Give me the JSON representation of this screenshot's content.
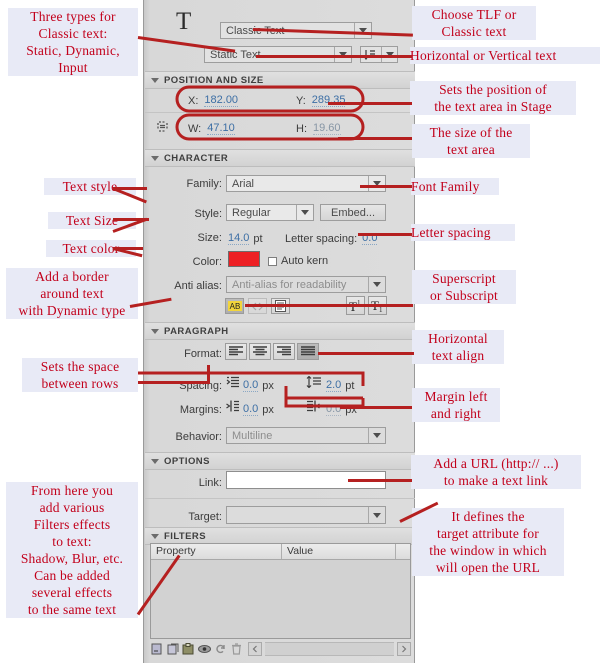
{
  "panel": {
    "title_icon": "text-tool-T",
    "text_engine": {
      "value": "Classic Text",
      "icon": "chevron-down-icon"
    },
    "text_type": {
      "value": "Static Text",
      "icon": "chevron-down-icon"
    },
    "orientation": {
      "icon": "text-orientation-icon",
      "caret": "chevron-down-icon"
    },
    "sections": {
      "position_size": {
        "title": "POSITION AND SIZE",
        "x_label": "X:",
        "x_value": "182.00",
        "y_label": "Y:",
        "y_value": "289.35",
        "w_label": "W:",
        "w_value": "47.10",
        "h_label": "H:",
        "h_value": "19.60",
        "lock_icon": "link-constrain-icon"
      },
      "character": {
        "title": "CHARACTER",
        "family_label": "Family:",
        "family_value": "Arial",
        "style_label": "Style:",
        "style_value": "Regular",
        "embed_label": "Embed...",
        "size_label": "Size:",
        "size_value": "14.0",
        "size_unit": "pt",
        "letter_spacing_label": "Letter spacing:",
        "letter_spacing_value": "0.0",
        "color_label": "Color:",
        "color_value": "#ED2024",
        "auto_kern_label": "Auto kern",
        "antialias_label": "Anti alias:",
        "antialias_value": "Anti-alias for readability",
        "toggle_selectable": "selectable-AB-icon",
        "toggle_html": "render-html-icon",
        "toggle_border": "show-border-icon",
        "superscript": "superscript-icon",
        "subscript": "subscript-icon"
      },
      "paragraph": {
        "title": "PARAGRAPH",
        "format_label": "Format:",
        "align_left": "align-left-icon",
        "align_center": "align-center-icon",
        "align_right": "align-right-icon",
        "align_justify": "align-justify-icon",
        "spacing_label": "Spacing:",
        "indent_value": "0.0",
        "indent_unit": "px",
        "indent_icon": "indent-icon",
        "line_spacing_value": "2.0",
        "line_spacing_unit": "pt",
        "line_spacing_icon": "line-spacing-icon",
        "margins_label": "Margins:",
        "margin_left_value": "0.0",
        "margin_left_unit": "px",
        "margin_left_icon": "margin-left-icon",
        "margin_right_value": "0.0",
        "margin_right_unit": "px",
        "margin_right_icon": "margin-right-icon",
        "behavior_label": "Behavior:",
        "behavior_value": "Multiline"
      },
      "options": {
        "title": "OPTIONS",
        "link_label": "Link:",
        "link_value": "",
        "link_placeholder": "",
        "target_label": "Target:",
        "target_value": ""
      },
      "filters": {
        "title": "FILTERS",
        "col_property": "Property",
        "col_value": "Value",
        "rows": [],
        "toolbar_icons": [
          "add-filter-icon",
          "preset-filter-icon",
          "clipboard-filter-icon",
          "enable-filter-icon",
          "reset-filter-icon",
          "delete-filter-icon",
          "scroll-left-icon",
          "scroll-right-icon"
        ]
      }
    }
  },
  "annotations": {
    "left": [
      {
        "id": "three-types",
        "text": "Three types for\nClassic text:\nStatic, Dynamic,\nInput"
      },
      {
        "id": "text-style",
        "text": "Text style"
      },
      {
        "id": "text-size",
        "text": "Text Size"
      },
      {
        "id": "text-color",
        "text": "Text color"
      },
      {
        "id": "add-border",
        "text": "Add a border\naround text\nwith Dynamic type"
      },
      {
        "id": "row-space",
        "text": "Sets the space\nbetween rows"
      },
      {
        "id": "filters-note",
        "text": "From here you\nadd various\nFilters effects\nto text:\nShadow, Blur, etc.\nCan be added\nseveral effects\nto the same text"
      }
    ],
    "right": [
      {
        "id": "choose-engine",
        "text": "Choose TLF or\nClassic text"
      },
      {
        "id": "orientation",
        "text": "Horizontal or Vertical text"
      },
      {
        "id": "position",
        "text": "Sets the position  of\nthe text area in Stage"
      },
      {
        "id": "size",
        "text": "The size of the\ntext area"
      },
      {
        "id": "font-family",
        "text": "Font Family"
      },
      {
        "id": "letter-spacing",
        "text": "Letter spacing"
      },
      {
        "id": "superscript",
        "text": "Superscript\nor Subscript"
      },
      {
        "id": "halign",
        "text": "Horizontal\ntext align"
      },
      {
        "id": "margins",
        "text": "Margin left\nand right"
      },
      {
        "id": "url",
        "text": "Add a URL (http:// ...)\nto make a text link"
      },
      {
        "id": "target",
        "text": "It defines the\ntarget attribute for\nthe window in which\nwill open the URL"
      }
    ]
  },
  "colors": {
    "annotation_text": "#c2001b",
    "annotation_bg": "#e8eaf6",
    "leader_line": "#b52020",
    "value_blue": "#3d6fa5"
  }
}
